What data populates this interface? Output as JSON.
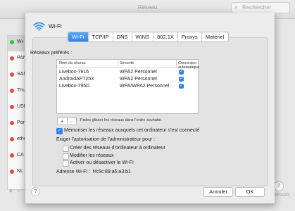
{
  "window": {
    "title": "Réseau",
    "search_placeholder": "Rechercher"
  },
  "sidebar": {
    "items": [
      {
        "label": "Wi-",
        "status_color": "#36c03d"
      },
      {
        "label": "PAN",
        "status_color": "#e24b45"
      },
      {
        "label": "SAM",
        "status_color": "#e24b45"
      },
      {
        "label": "Thu",
        "status_color": "#e24b45"
      },
      {
        "label": "USB",
        "status_color": "#e24b45"
      },
      {
        "label": "Por",
        "status_color": "#e24b45"
      },
      {
        "label": "ethe",
        "status_color": "#e24b45"
      },
      {
        "label": "CA",
        "status_color": "#e24b45"
      },
      {
        "label": "NL",
        "status_color": "#e24b45"
      }
    ],
    "add_label": "+",
    "remove_label": "−"
  },
  "sheet": {
    "title": "Wi-Fi",
    "tabs": [
      {
        "label": "Wi-Fi",
        "active": true
      },
      {
        "label": "TCP/IP",
        "active": false
      },
      {
        "label": "DNS",
        "active": false
      },
      {
        "label": "WINS",
        "active": false
      },
      {
        "label": "802.1X",
        "active": false
      },
      {
        "label": "Proxys",
        "active": false
      },
      {
        "label": "Matériel",
        "active": false
      }
    ],
    "preferred_label": "Réseaux préférés :",
    "table": {
      "headers": [
        "Nom de réseau",
        "Sécurité",
        "Connexion automatique"
      ],
      "rows": [
        {
          "name": "Livebox-7916",
          "security": "WPA2 Personnel",
          "auto": true
        },
        {
          "name": "AndroidAP7253",
          "security": "WPA2 Personnel",
          "auto": true
        },
        {
          "name": "Livebox-795D",
          "security": "WPA/WPA2 Personnel",
          "auto": true
        }
      ]
    },
    "add_label": "+",
    "remove_label": "−",
    "drag_hint": "Faites glisser les réseaux dans l’ordre souhaité.",
    "remember_label": "Mémoriser les réseaux auxquels cet ordinateur s’est connecté",
    "remember_checked": true,
    "admin_label": "Exiger l’autorisation de l’administrateur pour :",
    "admin_options": [
      {
        "label": "Créer des réseaux d’ordinateur à ordinateur",
        "checked": false
      },
      {
        "label": "Modifier les réseaux",
        "checked": false
      },
      {
        "label": "Activer ou désactiver le Wi-Fi",
        "checked": false
      }
    ],
    "address_label": "Adresse Wi-Fi :",
    "address_value": "f4:5c:89:a5:a3:b1",
    "help_label": "?",
    "cancel_label": "Annuler",
    "ok_label": "OK"
  },
  "background": {
    "help_label": "?",
    "revert_label": "Rétablir"
  }
}
